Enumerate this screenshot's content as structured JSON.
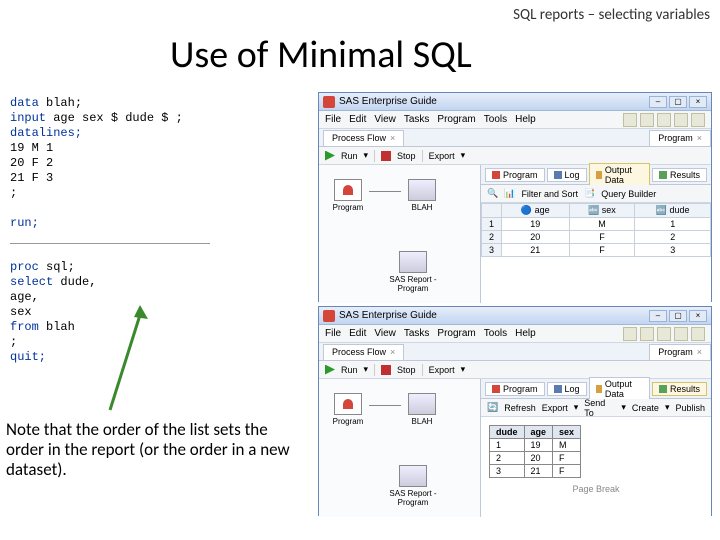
{
  "header_label": "SQL reports – selecting variables",
  "main_title": "Use of Minimal SQL",
  "code1": {
    "l1a": "data",
    "l1b": " blah;",
    "l2a": "    input",
    "l2b": " age sex $ dude $ ;",
    "l3": "    datalines;",
    "d1": "19 M 1",
    "d2": "20 F 2",
    "d3": "21 F 3",
    "d4": "    ;",
    "l4": "run;"
  },
  "code2": {
    "l1a": "proc",
    "l1b": " sql;",
    "l2a": "        select",
    "l2b": "  dude,",
    "l3": "                age,",
    "l4": "                sex",
    "l5a": "                from",
    "l5b": " blah",
    "l6": "     ;",
    "l7": "quit;"
  },
  "note": "Note that the order of the list sets the order in the report (or the order in a new dataset).",
  "app": {
    "title": "SAS Enterprise Guide",
    "menus": [
      "File",
      "Edit",
      "View",
      "Tasks",
      "Program",
      "Tools",
      "Help"
    ],
    "tab_flow": "Process Flow",
    "tab_prog": "Program",
    "run": "Run",
    "stop": "Stop",
    "export": "Export",
    "flow_program": "Program",
    "flow_blah": "BLAH",
    "flow_sasreport": "SAS Report - Program",
    "rtab_program": "Program",
    "rtab_log": "Log",
    "rtab_output": "Output Data",
    "rtab_results": "Results",
    "filter_sort": "Filter and Sort",
    "query": "Query Builder",
    "refresh": "Refresh",
    "exportr": "Export",
    "sendto": "Send To",
    "create": "Create",
    "publish": "Publish",
    "page_break": "Page Break"
  },
  "grid": {
    "cols": [
      "age",
      "sex",
      "dude"
    ],
    "rows": [
      [
        "19",
        "M",
        "1"
      ],
      [
        "20",
        "F",
        "2"
      ],
      [
        "21",
        "F",
        "3"
      ]
    ]
  },
  "report": {
    "cols": [
      "dude",
      "age",
      "sex"
    ],
    "rows": [
      [
        "1",
        "19",
        "M"
      ],
      [
        "2",
        "20",
        "F"
      ],
      [
        "3",
        "21",
        "F"
      ]
    ]
  }
}
